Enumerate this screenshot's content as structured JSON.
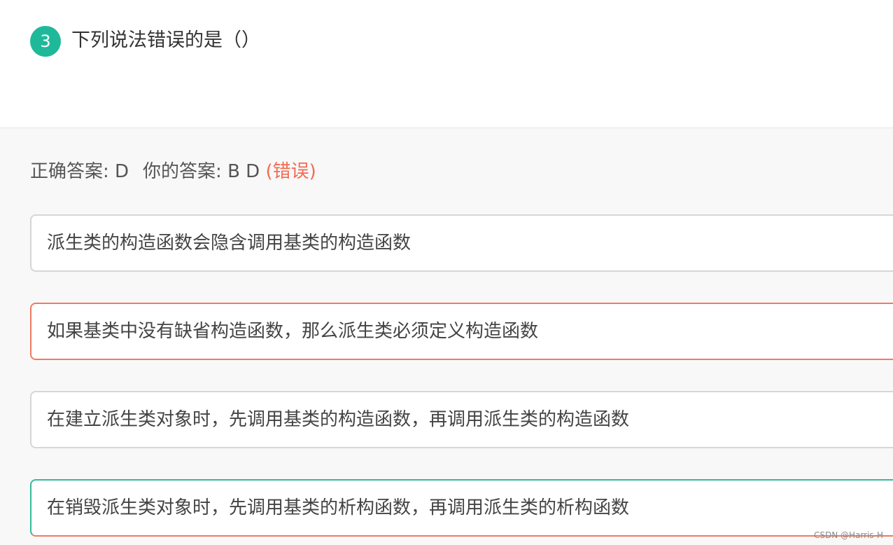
{
  "question": {
    "number": "3",
    "title": "下列说法错误的是（）"
  },
  "result": {
    "correct_label": "正确答案: D",
    "your_label": "你的答案: B D",
    "status": "(错误)"
  },
  "options": [
    {
      "text": "派生类的构造函数会隐含调用基类的构造函数",
      "state": "neutral"
    },
    {
      "text": "如果基类中没有缺省构造函数，那么派生类必须定义构造函数",
      "state": "wrong-selected"
    },
    {
      "text": "在建立派生类对象时，先调用基类的构造函数，再调用派生类的构造函数",
      "state": "neutral"
    },
    {
      "text": "在销毁派生类对象时，先调用基类的析构函数，再调用派生类的析构函数",
      "state": "correct-selected"
    }
  ],
  "watermark": "CSDN @Harris-H",
  "colors": {
    "accent_green": "#1fb99a",
    "wrong_red": "#f26b50",
    "border_grey": "#d6d6d6"
  }
}
